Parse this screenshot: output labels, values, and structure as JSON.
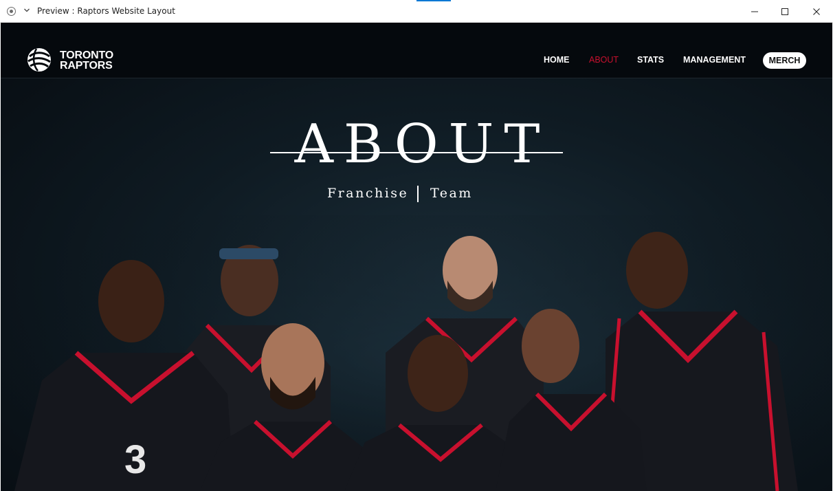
{
  "window": {
    "title": "Preview : Raptors Website Layout"
  },
  "nav": {
    "logo_line1": "TORONTO",
    "logo_line2": "RAPTORS",
    "links": [
      {
        "label": "HOME",
        "active": false
      },
      {
        "label": "ABOUT",
        "active": true
      },
      {
        "label": "STATS",
        "active": false
      },
      {
        "label": "MANAGEMENT",
        "active": false
      }
    ],
    "merch_label": "MERCH"
  },
  "hero": {
    "title": "ABOUT",
    "sub_left": "Franchise",
    "sub_right": "Team"
  },
  "colors": {
    "accent_red": "#c8102e",
    "nav_bg": "#05090d",
    "hero_bg": "#0f1b23"
  },
  "icons": [
    "app-icon",
    "chevron-down-icon",
    "minimize-icon",
    "maximize-icon",
    "close-icon",
    "raptors-ball-logo-icon"
  ]
}
